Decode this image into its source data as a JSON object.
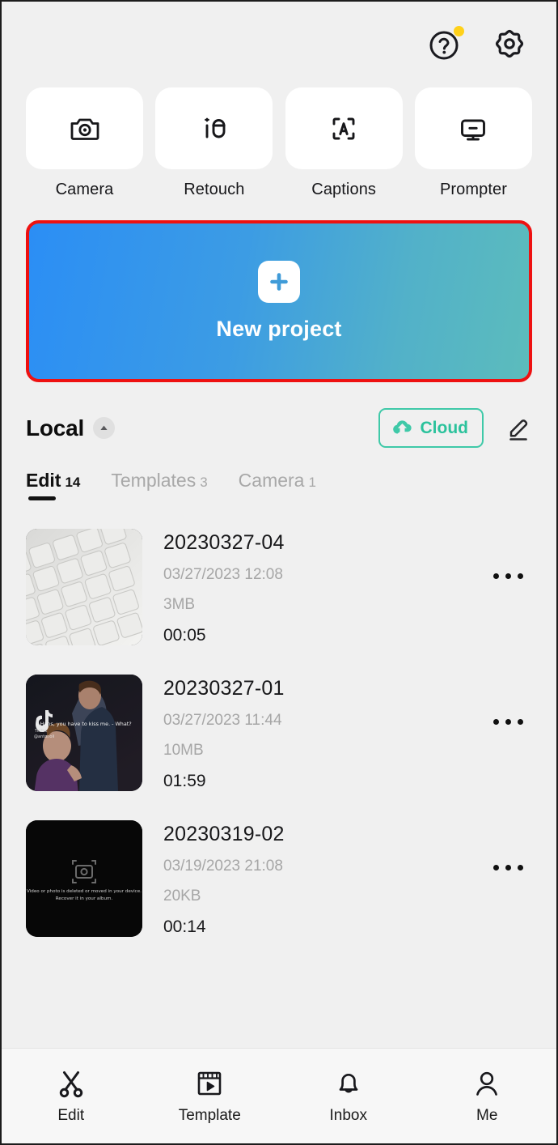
{
  "topbar": {
    "help": {
      "icon": "help-circle-icon",
      "badge": true
    },
    "settings": {
      "icon": "gear-icon"
    }
  },
  "quick_actions": [
    {
      "label": "Camera",
      "icon": "camera-icon"
    },
    {
      "label": "Retouch",
      "icon": "retouch-icon"
    },
    {
      "label": "Captions",
      "icon": "captions-icon"
    },
    {
      "label": "Prompter",
      "icon": "prompter-icon"
    }
  ],
  "banner": {
    "label": "New project",
    "icon": "plus-icon",
    "gradient_from": "#2b8ef5",
    "gradient_to": "#5cbcbc",
    "highlight_color": "#ee1111"
  },
  "local": {
    "title": "Local",
    "collapse_icon": "caret-up-icon",
    "cloud_label": "Cloud",
    "cloud_icon": "cloud-upload-icon",
    "cloud_color": "#2bc29c",
    "edit_icon": "pencil-icon"
  },
  "tabs": [
    {
      "name": "Edit",
      "count": "14",
      "active": true
    },
    {
      "name": "Templates",
      "count": "3",
      "active": false
    },
    {
      "name": "Camera",
      "count": "1",
      "active": false
    }
  ],
  "projects": [
    {
      "title": "20230327-04",
      "date": "03/27/2023 12:08",
      "size": "3MB",
      "duration": "00:05",
      "thumbnail": "keyboard-photo",
      "more_icon": "more-horizontal-icon"
    },
    {
      "title": "20230327-01",
      "date": "03/27/2023 11:44",
      "size": "10MB",
      "duration": "01:59",
      "thumbnail": "animation-scene-photo",
      "thumbnail_caption": "- Hans, you have to kiss me. - What?",
      "thumbnail_watermark": "TikTok",
      "more_icon": "more-horizontal-icon"
    },
    {
      "title": "20230319-02",
      "date": "03/19/2023 21:08",
      "size": "20KB",
      "duration": "00:14",
      "thumbnail": "missing-media-placeholder",
      "thumbnail_message_line1": "Video or photo is deleted or moved in your device.",
      "thumbnail_message_line2": "Recover it in your album.",
      "more_icon": "more-horizontal-icon"
    }
  ],
  "bottom_nav": [
    {
      "label": "Edit",
      "icon": "scissors-icon"
    },
    {
      "label": "Template",
      "icon": "film-play-icon"
    },
    {
      "label": "Inbox",
      "icon": "bell-icon"
    },
    {
      "label": "Me",
      "icon": "person-icon"
    }
  ]
}
